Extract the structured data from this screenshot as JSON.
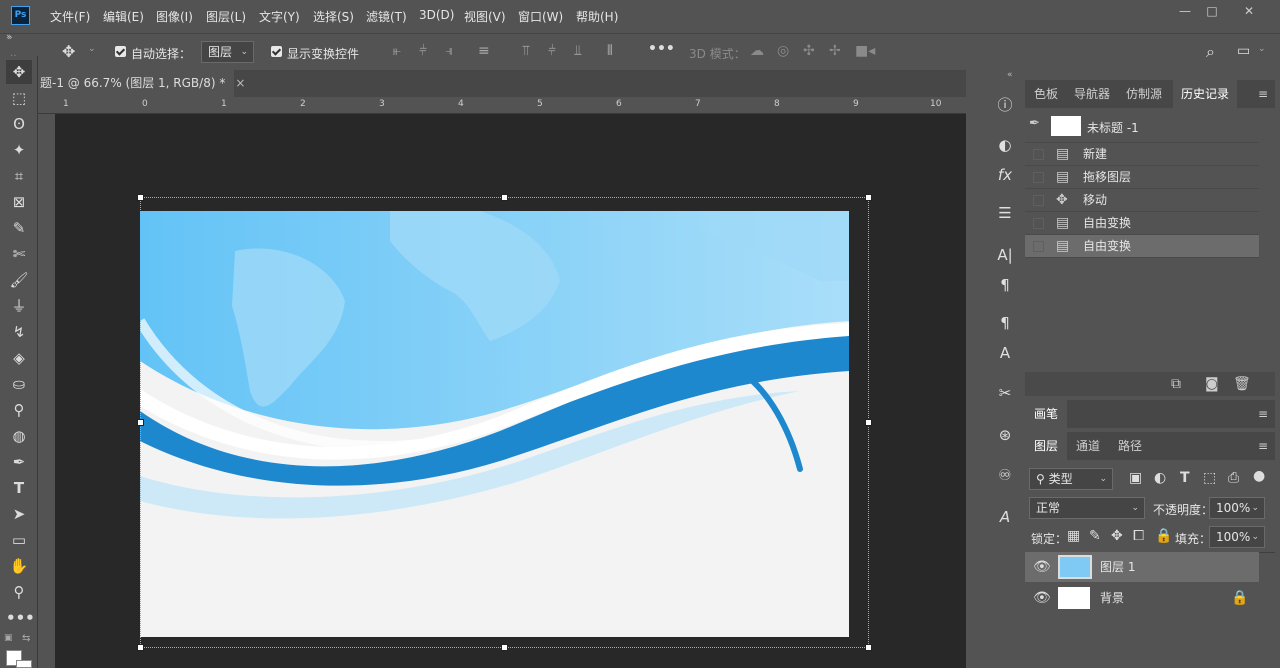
{
  "app": {
    "logo": "Ps"
  },
  "menus": [
    "文件(F)",
    "编辑(E)",
    "图像(I)",
    "图层(L)",
    "文字(Y)",
    "选择(S)",
    "滤镜(T)",
    "3D(D)",
    "视图(V)",
    "窗口(W)",
    "帮助(H)"
  ],
  "options": {
    "auto_select_label": "自动选择：",
    "auto_select_value": "图层",
    "show_transform_label": "显示变换控件",
    "mode_3d_label": "3D 模式："
  },
  "document": {
    "tab_title": "题-1 @ 66.7% (图层 1, RGB/8) *",
    "close": "×"
  },
  "ruler": {
    "h_ticks": [
      "1",
      "0",
      "1",
      "2",
      "3",
      "4",
      "5",
      "6",
      "7",
      "8",
      "9",
      "10"
    ]
  },
  "panels": {
    "top_tabs": [
      "色板",
      "导航器",
      "仿制源",
      "历史记录"
    ],
    "active_top_tab": "历史记录",
    "history": {
      "snapshot": "未标题 -1",
      "items": [
        "新建",
        "拖移图层",
        "移动",
        "自由变换",
        "自由变换"
      ]
    },
    "brush_tab": "画笔",
    "layer_tabs": [
      "图层",
      "通道",
      "路径"
    ],
    "filter_kind": "类型",
    "blend_mode": "正常",
    "opacity_label": "不透明度：",
    "opacity_value": "100%",
    "lock_label": "锁定：",
    "fill_label": "填充：",
    "fill_value": "100%",
    "layers": [
      {
        "name": "图层 1"
      },
      {
        "name": "背景"
      }
    ]
  },
  "colors": {
    "accent": "#3ea1f4",
    "canvas_bg": "#282828",
    "panel_bg": "#535353"
  }
}
